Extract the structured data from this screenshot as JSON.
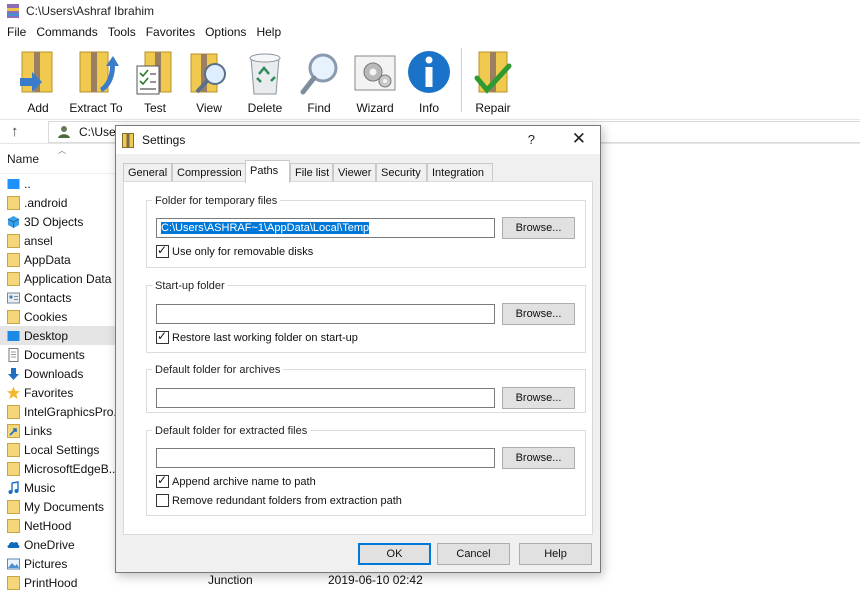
{
  "window": {
    "title": "C:\\Users\\Ashraf Ibrahim"
  },
  "menu": [
    "File",
    "Commands",
    "Tools",
    "Favorites",
    "Options",
    "Help"
  ],
  "toolbar": {
    "buttons": [
      {
        "label": "Add",
        "icon": "add-archive-icon"
      },
      {
        "label": "Extract To",
        "icon": "extract-to-icon"
      },
      {
        "label": "Test",
        "icon": "test-icon"
      },
      {
        "label": "View",
        "icon": "view-icon"
      },
      {
        "label": "Delete",
        "icon": "recycle-bin-icon"
      },
      {
        "label": "Find",
        "icon": "magnifier-icon"
      },
      {
        "label": "Wizard",
        "icon": "wizard-icon"
      },
      {
        "label": "Info",
        "icon": "info-icon"
      },
      {
        "label": "Repair",
        "icon": "repair-icon"
      }
    ]
  },
  "address": {
    "text": "C:\\User"
  },
  "filelist": {
    "header": "Name",
    "items": [
      {
        "name": "..",
        "icon": "drive-icon"
      },
      {
        "name": ".android",
        "icon": "folder-icon"
      },
      {
        "name": "3D Objects",
        "icon": "3d-objects-icon"
      },
      {
        "name": "ansel",
        "icon": "folder-icon"
      },
      {
        "name": "AppData",
        "icon": "folder-icon"
      },
      {
        "name": "Application Data",
        "icon": "folder-icon"
      },
      {
        "name": "Contacts",
        "icon": "contacts-icon"
      },
      {
        "name": "Cookies",
        "icon": "folder-icon"
      },
      {
        "name": "Desktop",
        "icon": "desktop-icon",
        "selected": true
      },
      {
        "name": "Documents",
        "icon": "documents-icon"
      },
      {
        "name": "Downloads",
        "icon": "downloads-icon"
      },
      {
        "name": "Favorites",
        "icon": "favorites-icon"
      },
      {
        "name": "IntelGraphicsPro...",
        "icon": "folder-icon"
      },
      {
        "name": "Links",
        "icon": "links-icon"
      },
      {
        "name": "Local Settings",
        "icon": "folder-icon"
      },
      {
        "name": "MicrosoftEdgeB...",
        "icon": "folder-icon"
      },
      {
        "name": "Music",
        "icon": "music-icon"
      },
      {
        "name": "My Documents",
        "icon": "folder-icon"
      },
      {
        "name": "NetHood",
        "icon": "folder-icon"
      },
      {
        "name": "OneDrive",
        "icon": "onedrive-icon"
      },
      {
        "name": "Pictures",
        "icon": "pictures-icon"
      },
      {
        "name": "PrintHood",
        "icon": "folder-icon"
      }
    ],
    "last_row_type": "Junction",
    "last_row_modified": "2019-06-10 02:42"
  },
  "dialog": {
    "title": "Settings",
    "help_glyph": "?",
    "close_glyph": "✕",
    "tabs": [
      "General",
      "Compression",
      "Paths",
      "File list",
      "Viewer",
      "Security",
      "Integration"
    ],
    "active_tab": "Paths",
    "groups": {
      "temp": {
        "label": "Folder for temporary files",
        "value": "C:\\Users\\ASHRAF~1\\AppData\\Local\\Temp",
        "browse": "Browse...",
        "checkbox_label": "Use only for removable disks",
        "checked": true
      },
      "startup": {
        "label": "Start-up folder",
        "value": "",
        "browse": "Browse...",
        "checkbox_label": "Restore last working folder on start-up",
        "checked": true
      },
      "archives": {
        "label": "Default folder for archives",
        "value": "",
        "browse": "Browse..."
      },
      "extracted": {
        "label": "Default folder for extracted files",
        "value": "",
        "browse": "Browse...",
        "checkbox1_label": "Append archive name to path",
        "checkbox1_checked": true,
        "checkbox2_label": "Remove redundant folders from extraction path",
        "checkbox2_checked": false
      }
    },
    "buttons": {
      "ok": "OK",
      "cancel": "Cancel",
      "help": "Help"
    }
  },
  "colors": {
    "selection": "#0078d7",
    "folder": "#f5d67a",
    "info_blue": "#1a73c9",
    "dialog_bg": "#f0f0f0"
  }
}
